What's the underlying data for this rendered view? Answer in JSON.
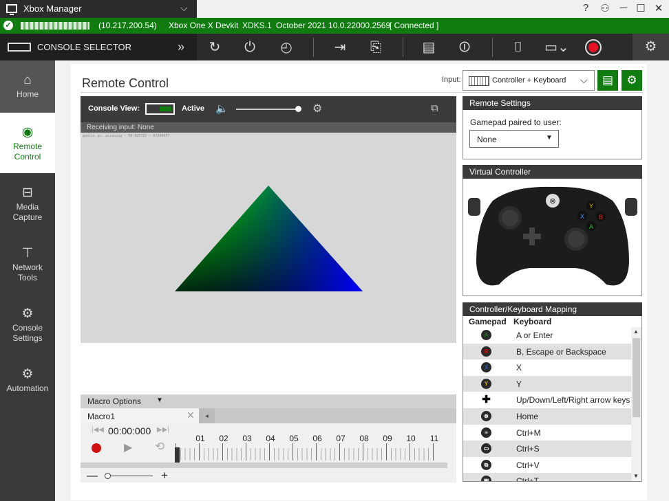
{
  "window": {
    "app_title": "Xbox Manager",
    "help": "?",
    "feedback": "⚇",
    "minimize": "─",
    "maximize": "☐",
    "close": "✕"
  },
  "status": {
    "ip": "(10.217.200.54)",
    "console_type": "Xbox One X Devkit",
    "build": "XDKS.1",
    "os": "October 2021 10.0.22000.2569",
    "state": "[ Connected ]",
    "accent": "#107c10"
  },
  "toolbar": {
    "selector_label": "CONSOLE SELECTOR",
    "icons": [
      "restart-icon",
      "power-icon",
      "timer-icon",
      "deploy-icon",
      "file-explorer-icon",
      "capture-screenshot-icon",
      "reboot-icon",
      "camera-icon",
      "video-icon",
      "record-icon",
      "settings-icon"
    ]
  },
  "nav": {
    "items": [
      {
        "id": "home",
        "label": "Home"
      },
      {
        "id": "remote",
        "label": "Remote Control"
      },
      {
        "id": "media",
        "label": "Media Capture"
      },
      {
        "id": "network",
        "label": "Network Tools"
      },
      {
        "id": "console",
        "label": "Console Settings"
      },
      {
        "id": "automation",
        "label": "Automation"
      }
    ]
  },
  "page": {
    "title": "Remote Control",
    "input_label": "Input:",
    "input_value": "Controller + Keyboard"
  },
  "console_view": {
    "label": "Console View:",
    "active": "Active",
    "receiving": "Receiving input: None",
    "debug_text": "goblin qc: aliasing - 59.925721 - 67266657"
  },
  "macro": {
    "options": "Macro Options",
    "tab": "Macro1",
    "time": "00:00:000",
    "ticks": [
      "01",
      "02",
      "03",
      "04",
      "05",
      "06",
      "07",
      "08",
      "09",
      "10",
      "11"
    ],
    "zoom_minus": "—",
    "zoom_plus": "+"
  },
  "remote_settings": {
    "title": "Remote Settings",
    "gamepad_label": "Gamepad paired to user:",
    "gamepad_value": "None"
  },
  "virtual_controller": {
    "title": "Virtual Controller"
  },
  "mapping": {
    "title": "Controller/Keyboard Mapping",
    "col_gamepad": "Gamepad",
    "col_keyboard": "Keyboard",
    "rows": [
      {
        "glyph": "A",
        "color": "#107c10",
        "keyboard": "A or Enter"
      },
      {
        "glyph": "B",
        "color": "#d01010",
        "keyboard": "B, Escape or Backspace"
      },
      {
        "glyph": "X",
        "color": "#1060d0",
        "keyboard": "X"
      },
      {
        "glyph": "Y",
        "color": "#e0b000",
        "keyboard": "Y"
      },
      {
        "glyph": "✚",
        "color": "#000000",
        "keyboard": "Up/Down/Left/Right arrow keys"
      },
      {
        "glyph": "⊗",
        "color": "#2a2a2a",
        "keyboard": "Home"
      },
      {
        "glyph": "≡",
        "color": "#2a2a2a",
        "keyboard": "Ctrl+M"
      },
      {
        "glyph": "▭",
        "color": "#2a2a2a",
        "keyboard": "Ctrl+S"
      },
      {
        "glyph": "⧉",
        "color": "#2a2a2a",
        "keyboard": "Ctrl+V"
      },
      {
        "glyph": "▣",
        "color": "#2a2a2a",
        "keyboard": "Ctrl+T"
      }
    ]
  }
}
